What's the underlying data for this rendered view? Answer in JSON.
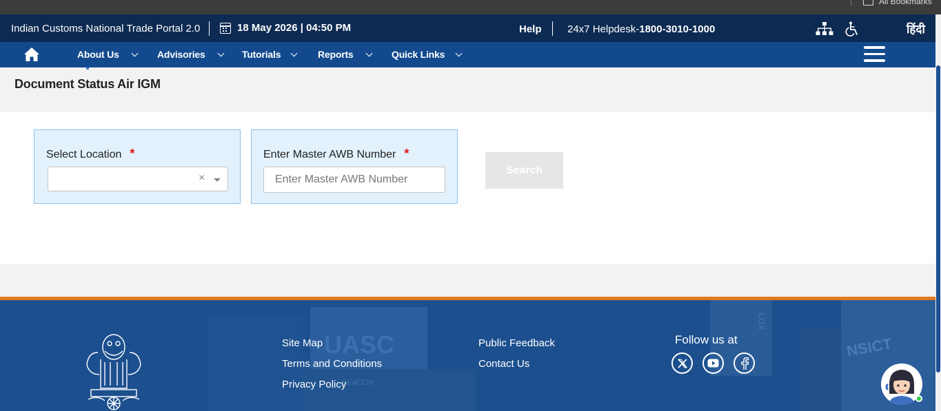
{
  "browser": {
    "bookmarks_label": "All Bookmarks"
  },
  "topbar": {
    "portal_name": "Indian Customs National Trade Portal 2.0",
    "datetime": "18 May 2026 | 04:50 PM",
    "help_label": "Help",
    "helpdesk_prefix": "24x7 Helpdesk-",
    "helpdesk_number": "1800-3010-1000",
    "language_label": "हिंदी",
    "icons": [
      "calendar-icon",
      "sitemap-icon",
      "accessibility-icon"
    ]
  },
  "nav": {
    "items": [
      {
        "label": "About Us"
      },
      {
        "label": "Advisories"
      },
      {
        "label": "Tutorials"
      },
      {
        "label": "Reports"
      },
      {
        "label": "Quick Links"
      }
    ]
  },
  "page": {
    "title": "Document Status Air IGM"
  },
  "form": {
    "location": {
      "label": "Select Location",
      "required_mark": "*",
      "value": ""
    },
    "awb": {
      "label": "Enter Master AWB Number",
      "required_mark": "*",
      "placeholder": "Enter Master AWB Number",
      "value": ""
    },
    "search_label": "Search"
  },
  "footer": {
    "col1": [
      "Site Map",
      "Terms and Conditions",
      "Privacy Policy"
    ],
    "col2": [
      "Public Feedback",
      "Contact Us"
    ],
    "follow_label": "Follow us at",
    "social": [
      "x-icon",
      "youtube-icon",
      "facebook-icon"
    ],
    "background_text": [
      "UASC",
      "NSICT",
      "BEACON",
      "LOX"
    ]
  },
  "colors": {
    "topbar": "#0d2a52",
    "navbar": "#134a8e",
    "footer": "#1c4f8e",
    "accent_line": "#e07a1f",
    "field_bg": "#e3f1fc",
    "required": "#e01818"
  }
}
